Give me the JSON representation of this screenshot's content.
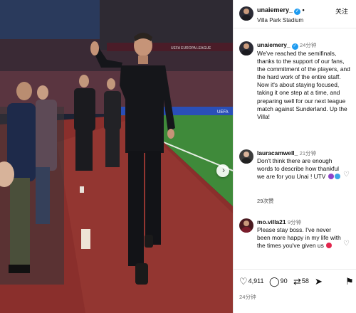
{
  "header": {
    "username": "unaiemery_",
    "follow_label": "关注",
    "location": "Villa Park Stadium"
  },
  "photo": {
    "banner_text": "UEFA EUROPA LEAGUE",
    "ad_text": "UEFA"
  },
  "caption": {
    "username": "unaiemery_",
    "time": "24分钟",
    "text": "We've reached the semifinals, thanks to the support of our fans, the commitment of the players, and the hard work of the entire staff. Now it's about staying focused, taking it one step at a time, and preparing well for our next league match against Sunderland. Up the Villa!"
  },
  "comments": [
    {
      "username": "lauracamwell_",
      "time": "21分钟",
      "text": "Don't think there are enough words to describe how thankful we are for you Unai ! UTV",
      "likes": "29次赞",
      "emojis": [
        "purple-heart",
        "blue-heart"
      ]
    },
    {
      "username": "mo.villa21",
      "time": "9分钟",
      "text": "Please stay boss. I've never been more happy in my life with the times you've given us",
      "emojis": [
        "red-heart"
      ]
    }
  ],
  "actions": {
    "likes": "4,911",
    "comments": "90",
    "reposts": "58"
  },
  "footer": {
    "time": "24分钟"
  },
  "colors": {
    "verified": "#1d9bf0",
    "purple_heart": "#8e44c9",
    "blue_heart": "#3ba6e6",
    "red_heart": "#e2264d",
    "track": "#8a2f2c",
    "pitch": "#3f8a3a"
  }
}
